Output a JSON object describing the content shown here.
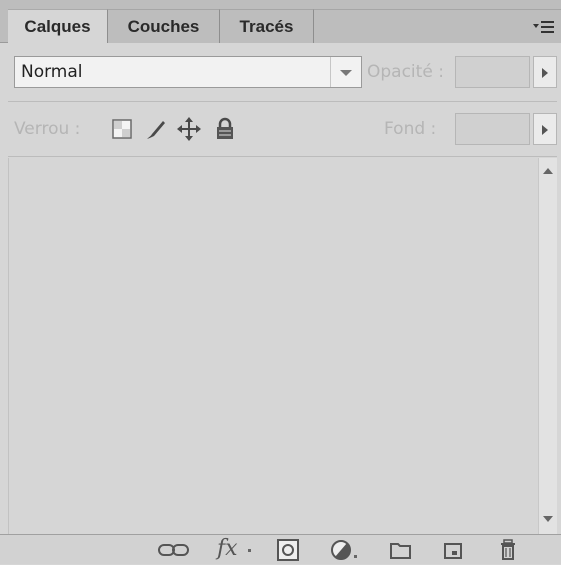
{
  "tabs": [
    {
      "label": "Calques",
      "active": true
    },
    {
      "label": "Couches",
      "active": false
    },
    {
      "label": "Tracés",
      "active": false
    }
  ],
  "panel_menu_icon": "panel-menu-icon",
  "blend_mode": {
    "value": "Normal",
    "icon": "chevron-down-icon"
  },
  "opacity": {
    "label": "Opacité :",
    "value": ""
  },
  "lock": {
    "label": "Verrou :",
    "icons": [
      "lock-transparent-pixels-icon",
      "lock-image-pixels-icon",
      "lock-position-icon",
      "lock-all-icon"
    ]
  },
  "fill": {
    "label": "Fond :",
    "value": ""
  },
  "layers": [],
  "bottom_icons": [
    "link-layers-icon",
    "fx-icon",
    "layer-mask-icon",
    "adjustment-layer-icon",
    "new-group-icon",
    "new-layer-icon",
    "delete-layer-icon"
  ],
  "bottom_fx_label": "fx"
}
